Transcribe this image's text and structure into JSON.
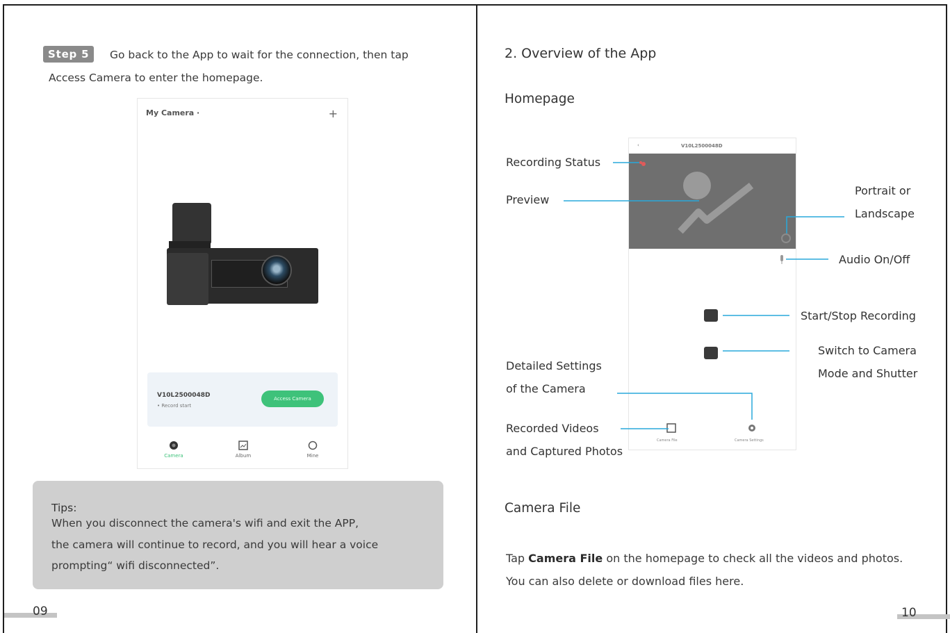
{
  "left_page": {
    "step_badge": "Step 5",
    "step_text_line1": "Go back to the App to wait for the connection, then tap",
    "step_text_line2": "Access Camera to enter the homepage.",
    "phone": {
      "title": "My Camera ·",
      "plus": "+",
      "device_name": "V10L2500048D",
      "device_sub": "• Record start",
      "access_button": "Access Camera",
      "tabs": [
        "Camera",
        "Album",
        "Mine"
      ]
    },
    "tips": {
      "title": "Tips:",
      "lines": [
        "When you disconnect the camera's wifi and exit the APP,",
        "the camera will continue to record, and you will hear a voice",
        "prompting“ wifi disconnected”."
      ]
    },
    "page_number": "09"
  },
  "right_page": {
    "section_title": "2. Overview of the App",
    "homepage_heading": "Homepage",
    "app_screen": {
      "back": "‹",
      "device_title": "V10L2500048D",
      "bottom_labels": [
        "Camera File",
        "Camera Settings"
      ]
    },
    "labels": {
      "recording_status": "Recording Status",
      "preview": "Preview",
      "portrait_l1": "Portrait or",
      "portrait_l2": "Landscape",
      "audio": "Audio On/Off",
      "start_stop": "Start/Stop Recording",
      "switch_l1": "Switch to Camera",
      "switch_l2": "Mode and Shutter",
      "settings_l1": "Detailed Settings",
      "settings_l2": "of the Camera",
      "recorded_l1": "Recorded Videos",
      "recorded_l2": "and Captured Photos"
    },
    "camera_file_heading": "Camera File",
    "camera_file_para": {
      "pre": "Tap ",
      "bold": "Camera File",
      "post": " on the homepage to check all the videos and photos.",
      "line2": "You can also delete or download files here."
    },
    "page_number": "10"
  },
  "colors": {
    "callout_line": "#29a9dc",
    "accent_green": "#3ec27a",
    "tips_bg": "#cfcfcf",
    "badge_bg": "#8a8a8a",
    "preview_bg": "#6f6f6f"
  }
}
